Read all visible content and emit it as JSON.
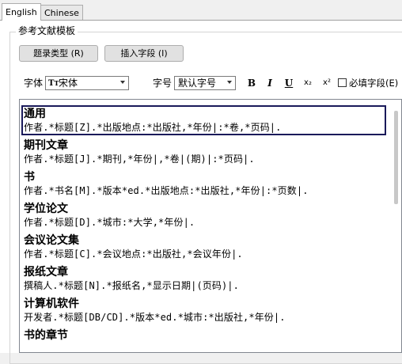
{
  "tabs": [
    {
      "label": "English",
      "active": true
    },
    {
      "label": "Chinese",
      "active": false
    }
  ],
  "group_title": "参考文献模板",
  "buttons": {
    "entry_type": "题录类型 (R)",
    "insert_field": "插入字段 (I)"
  },
  "font": {
    "label": "字体",
    "value": "宋体",
    "icon": "truetype-icon"
  },
  "font_size": {
    "label": "字号",
    "value": "默认字号"
  },
  "format": {
    "bold": "B",
    "italic": "I",
    "underline": "U",
    "subscript": "x₂",
    "superscript": "x²"
  },
  "required_field": {
    "label": "必填字段(E)",
    "checked": false
  },
  "templates": [
    {
      "title": "通用",
      "format": "作者.*标题[Z].*出版地点:*出版社,*年份|:*卷,*页码|."
    },
    {
      "title": "期刊文章",
      "format": "作者.*标题[J].*期刊,*年份|,*卷|(期)|:*页码|."
    },
    {
      "title": "书",
      "format": "作者.*书名[M].*版本*ed.*出版地点:*出版社,*年份|:*页数|."
    },
    {
      "title": "学位论文",
      "format": "作者.*标题[D].*城市:*大学,*年份|."
    },
    {
      "title": "会议论文集",
      "format": "作者.*标题[C].*会议地点:*出版社,*会议年份|."
    },
    {
      "title": "报纸文章",
      "format": "撰稿人.*标题[N].*报纸名,*显示日期|(页码)|."
    },
    {
      "title": "计算机软件",
      "format": "开发者.*标题[DB/CD].*版本*ed.*城市:*出版社,*年份|."
    },
    {
      "title": "书的章节",
      "format": ""
    }
  ],
  "colors": {
    "selection_border": "#1a1a5a",
    "tab_border": "#adadad"
  }
}
